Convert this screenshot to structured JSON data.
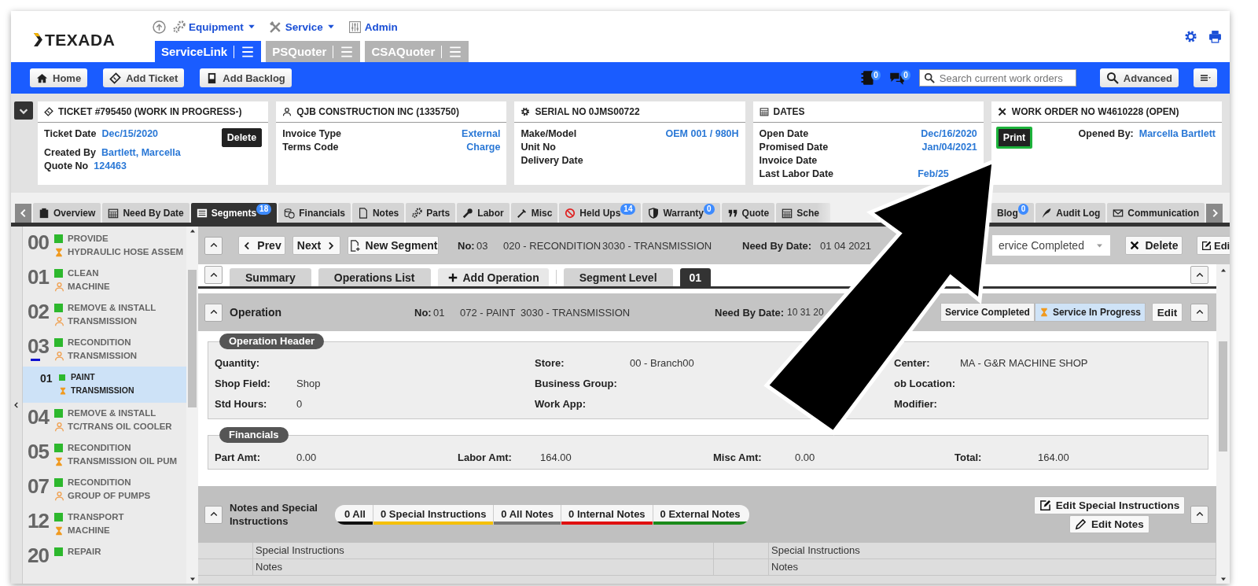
{
  "header": {
    "logo": "TEXADA",
    "nav": [
      {
        "label": "Equipment",
        "dropdown": true
      },
      {
        "label": "Service",
        "dropdown": true
      },
      {
        "label": "Admin",
        "dropdown": false
      }
    ],
    "apps": [
      {
        "label": "ServiceLink",
        "selected": true
      },
      {
        "label": "PSQuoter",
        "selected": false
      },
      {
        "label": "CSAQuoter",
        "selected": false
      }
    ]
  },
  "toolbar": {
    "buttons": [
      "Home",
      "Add Ticket",
      "Add Backlog"
    ],
    "indicators": [
      {
        "count": "0"
      },
      {
        "count": "0"
      }
    ],
    "search": {
      "placeholder": "Search current work orders"
    },
    "advanced": "Advanced"
  },
  "cards": [
    {
      "kind": "inline",
      "title": "TICKET #795450 (WORK IN PROGRESS-)",
      "button": {
        "label": "Delete",
        "highlighted": false
      },
      "rows": [
        {
          "label": "Ticket Date",
          "value": "Dec/15/2020"
        },
        {
          "label": "Created By",
          "value": "Bartlett, Marcella"
        },
        {
          "label": "Quote No",
          "value": "124463"
        }
      ]
    },
    {
      "kind": "spread",
      "title": "QJB CONSTRUCTION INC (1335750)",
      "rows": [
        {
          "label": "Invoice Type",
          "value": "External"
        },
        {
          "label": "Terms Code",
          "value": "Charge"
        }
      ]
    },
    {
      "kind": "spread",
      "title": "SERIAL NO 0JMS00722",
      "rows": [
        {
          "label": "Make/Model",
          "value": "OEM 001 / 980H"
        },
        {
          "label": "Unit No"
        },
        {
          "label": "Delivery Date"
        }
      ]
    },
    {
      "kind": "spread",
      "title": "DATES",
      "rows": [
        {
          "label": "Open Date",
          "value": "Dec/16/2020"
        },
        {
          "label": "Promised Date",
          "value": "Jan/04/2021"
        },
        {
          "label": "Invoice Date"
        },
        {
          "label": "Last Labor Date",
          "value": "Feb/25",
          "obscured": true
        }
      ]
    },
    {
      "kind": "opened",
      "title": "WORK ORDER NO W4610228 (OPEN)",
      "button": {
        "label": "Print",
        "highlighted": true
      },
      "rows": [
        {
          "label": "Opened By:",
          "value": "Marcella Bartlett"
        }
      ]
    }
  ],
  "tabs": [
    {
      "label": "Overview",
      "selected": false
    },
    {
      "label": "Need By Date",
      "selected": false
    },
    {
      "label": "Segments",
      "badge": "18",
      "selected": true
    },
    {
      "label": "Financials",
      "selected": false
    },
    {
      "label": "Notes",
      "selected": false
    },
    {
      "label": "Parts",
      "selected": false
    },
    {
      "label": "Labor",
      "selected": false
    },
    {
      "label": "Misc",
      "selected": false
    },
    {
      "label": "Held Ups",
      "badge": "14",
      "selected": false
    },
    {
      "label": "Warranty",
      "badge": "0",
      "selected": false
    },
    {
      "label": "Quote",
      "selected": false
    },
    {
      "label": "Sche",
      "selected": false,
      "obscured": true
    },
    {
      "label": "Blog",
      "badge": "0",
      "selected": false
    },
    {
      "label": "Audit Log",
      "selected": false
    },
    {
      "label": "Communication",
      "selected": false
    }
  ],
  "segments": [
    {
      "number": "00",
      "title": "PROVIDE",
      "subtitle": "HYDRAULIC HOSE ASSEM",
      "in_progress": true,
      "expanded": false,
      "selected": false
    },
    {
      "number": "01",
      "title": "CLEAN",
      "subtitle": "MACHINE",
      "in_progress": false,
      "expanded": false,
      "selected": false
    },
    {
      "number": "02",
      "title": "REMOVE & INSTALL",
      "subtitle": "TRANSMISSION",
      "in_progress": false,
      "expanded": false,
      "selected": false
    },
    {
      "number": "03",
      "title": "RECONDITION",
      "subtitle": "TRANSMISSION",
      "in_progress": false,
      "expanded": true,
      "selected": false,
      "children": [
        {
          "number": "01",
          "title": "PAINT",
          "subtitle": "TRANSMISSION",
          "in_progress": true,
          "selected": true
        }
      ]
    },
    {
      "number": "04",
      "title": "REMOVE & INSTALL",
      "subtitle": "TC/TRANS OIL COOLER",
      "in_progress": false,
      "expanded": false,
      "selected": false
    },
    {
      "number": "05",
      "title": "RECONDITION",
      "subtitle": "TRANSMISSION OIL PUM",
      "in_progress": true,
      "expanded": false,
      "selected": false
    },
    {
      "number": "07",
      "title": "RECONDITION",
      "subtitle": "GROUP OF PUMPS",
      "in_progress": false,
      "expanded": false,
      "selected": false
    },
    {
      "number": "12",
      "title": "TRANSPORT",
      "subtitle": "MACHINE",
      "in_progress": true,
      "expanded": false,
      "selected": false
    },
    {
      "number": "20",
      "title": "REPAIR",
      "expanded": false,
      "selected": false
    }
  ],
  "segment_bar": {
    "prev": "Prev",
    "next": "Next",
    "new_segment": "New Segment",
    "no_label": "No:",
    "no": "03",
    "job_code": "020 - RECONDITION",
    "component_code": "3030 - TRANSMISSION",
    "need_by_label": "Need By Date:",
    "need_by": "01 04 2021",
    "status": "ervice Completed",
    "delete": "Delete",
    "edit": "Edi"
  },
  "sub_tabs": [
    {
      "label": "Summary",
      "kind": "tab",
      "selected": false
    },
    {
      "label": "Operations List",
      "kind": "tab",
      "selected": false
    },
    {
      "label": "Add Operation",
      "kind": "action",
      "selected": false
    },
    {
      "label": "Segment Level",
      "kind": "tab",
      "selected": false
    },
    {
      "label": "01",
      "kind": "tab",
      "selected": true
    }
  ],
  "operation": {
    "title": "Operation",
    "no_label": "No:",
    "no": "01",
    "job_code": "072 - PAINT",
    "component_code": "3030 - TRANSMISSION",
    "need_by_label": "Need By Date:",
    "need_by": "10 31 20",
    "status_options": [
      {
        "label": "Service Completed",
        "selected": false
      },
      {
        "label": "Service In Progress",
        "selected": true
      }
    ],
    "edit": "Edit"
  },
  "operation_header": {
    "title": "Operation Header",
    "rows": [
      [
        {
          "label": "Quantity:"
        },
        {
          "label": "Store:",
          "value": "00 - Branch00"
        },
        {
          "label": "Center:",
          "value": "MA - G&R MACHINE SHOP"
        }
      ],
      [
        {
          "label": "Shop Field:",
          "value": "Shop"
        },
        {
          "label": "Business Group:"
        },
        {
          "label": "ob Location:"
        }
      ],
      [
        {
          "label": "Std Hours:",
          "value": "0"
        },
        {
          "label": "Work App:"
        },
        {
          "label": "Modifier:"
        }
      ]
    ]
  },
  "financials": {
    "title": "Financials",
    "fields": [
      {
        "label": "Part Amt:",
        "value": "0.00"
      },
      {
        "label": "Labor Amt:",
        "value": "164.00"
      },
      {
        "label": "Misc Amt:",
        "value": "0.00"
      },
      {
        "label": "Total:",
        "value": "164.00"
      }
    ]
  },
  "notes": {
    "title": "Notes and Special Instructions",
    "filters": [
      {
        "label": "0 All",
        "color": "#111111"
      },
      {
        "label": "0 Special Instructions",
        "color": "#f5c000"
      },
      {
        "label": "0 All Notes",
        "color": "#777777"
      },
      {
        "label": "0 Internal Notes",
        "color": "#e01010"
      },
      {
        "label": "0 External Notes",
        "color": "#1a8a1a"
      }
    ],
    "buttons": [
      "Edit Special Instructions",
      "Edit Notes"
    ]
  },
  "notes_table": {
    "rows": [
      [
        "Special Instructions",
        "Special Instructions"
      ],
      [
        "Notes",
        "Notes"
      ]
    ]
  }
}
